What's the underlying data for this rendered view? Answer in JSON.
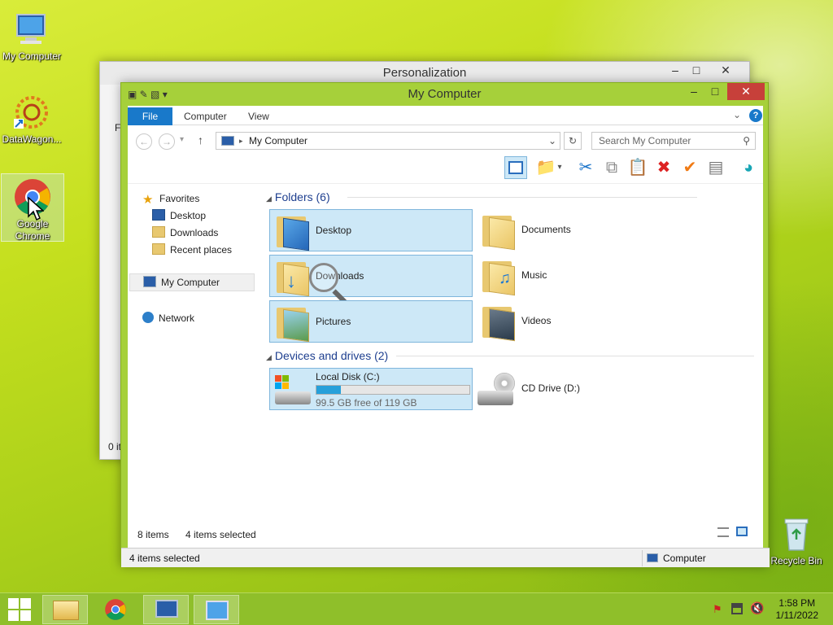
{
  "desktop": {
    "icons": [
      {
        "label": "My Computer"
      },
      {
        "label": "DataWagon..."
      },
      {
        "label": "Google Chrome"
      },
      {
        "label": "Recycle Bin"
      }
    ]
  },
  "bg_window": {
    "title": "Personalization",
    "left_letter": "Fi",
    "status": "0 it"
  },
  "window": {
    "title": "My Computer",
    "ribbon": {
      "file": "File",
      "computer": "Computer",
      "view": "View"
    },
    "address": "My Computer",
    "search_placeholder": "Search My Computer",
    "nav": {
      "favorites": "Favorites",
      "desktop": "Desktop",
      "downloads": "Downloads",
      "recent": "Recent places",
      "computer": "My Computer",
      "network": "Network"
    },
    "groups": {
      "folders": "Folders (6)",
      "devices": "Devices and drives (2)"
    },
    "folders": [
      {
        "label": "Desktop"
      },
      {
        "label": "Documents"
      },
      {
        "label": "Downloads"
      },
      {
        "label": "Music"
      },
      {
        "label": "Pictures"
      },
      {
        "label": "Videos"
      }
    ],
    "drives": {
      "c_label": "Local Disk (C:)",
      "c_free": "99.5 GB free of 119 GB",
      "c_used_fraction": 0.16,
      "d_label": "CD Drive (D:)"
    },
    "status": {
      "items": "8 items",
      "selected": "4 items selected",
      "bottom_selected": "4 items selected",
      "bottom_location": "Computer"
    }
  },
  "taskbar": {
    "time": "1:58 PM",
    "date": "1/11/2022"
  }
}
